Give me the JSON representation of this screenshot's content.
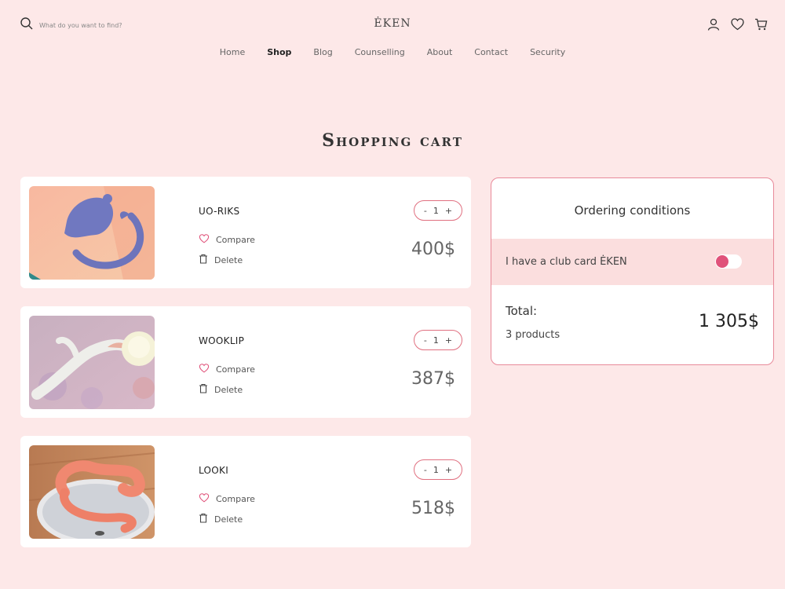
{
  "header": {
    "search_placeholder": "What do you want to find?",
    "logo": "ĖKEN",
    "nav": [
      "Home",
      "Shop",
      "Blog",
      "Counselling",
      "About",
      "Contact",
      "Security"
    ],
    "active_nav": "Shop"
  },
  "page_title": "Shopping cart",
  "cart": {
    "items": [
      {
        "name": "UO-RIKS",
        "quantity": "1",
        "minus": "-",
        "plus": "+",
        "price": "400$",
        "compare_label": "Compare",
        "delete_label": "Delete"
      },
      {
        "name": "WOOKLIP",
        "quantity": "1",
        "minus": "-",
        "plus": "+",
        "price": "387$",
        "compare_label": "Compare",
        "delete_label": "Delete"
      },
      {
        "name": "LOOKI",
        "quantity": "1",
        "minus": "-",
        "plus": "+",
        "price": "518$",
        "compare_label": "Compare",
        "delete_label": "Delete"
      }
    ]
  },
  "summary": {
    "title": "Ordering conditions",
    "club_card_label": "I have a club card ĖKEN",
    "total_label": "Total:",
    "product_count": "3 products",
    "total_value": "1 305$"
  },
  "colors": {
    "background": "#fde8e8",
    "accent": "#e0527a",
    "border": "#e88a9a"
  }
}
